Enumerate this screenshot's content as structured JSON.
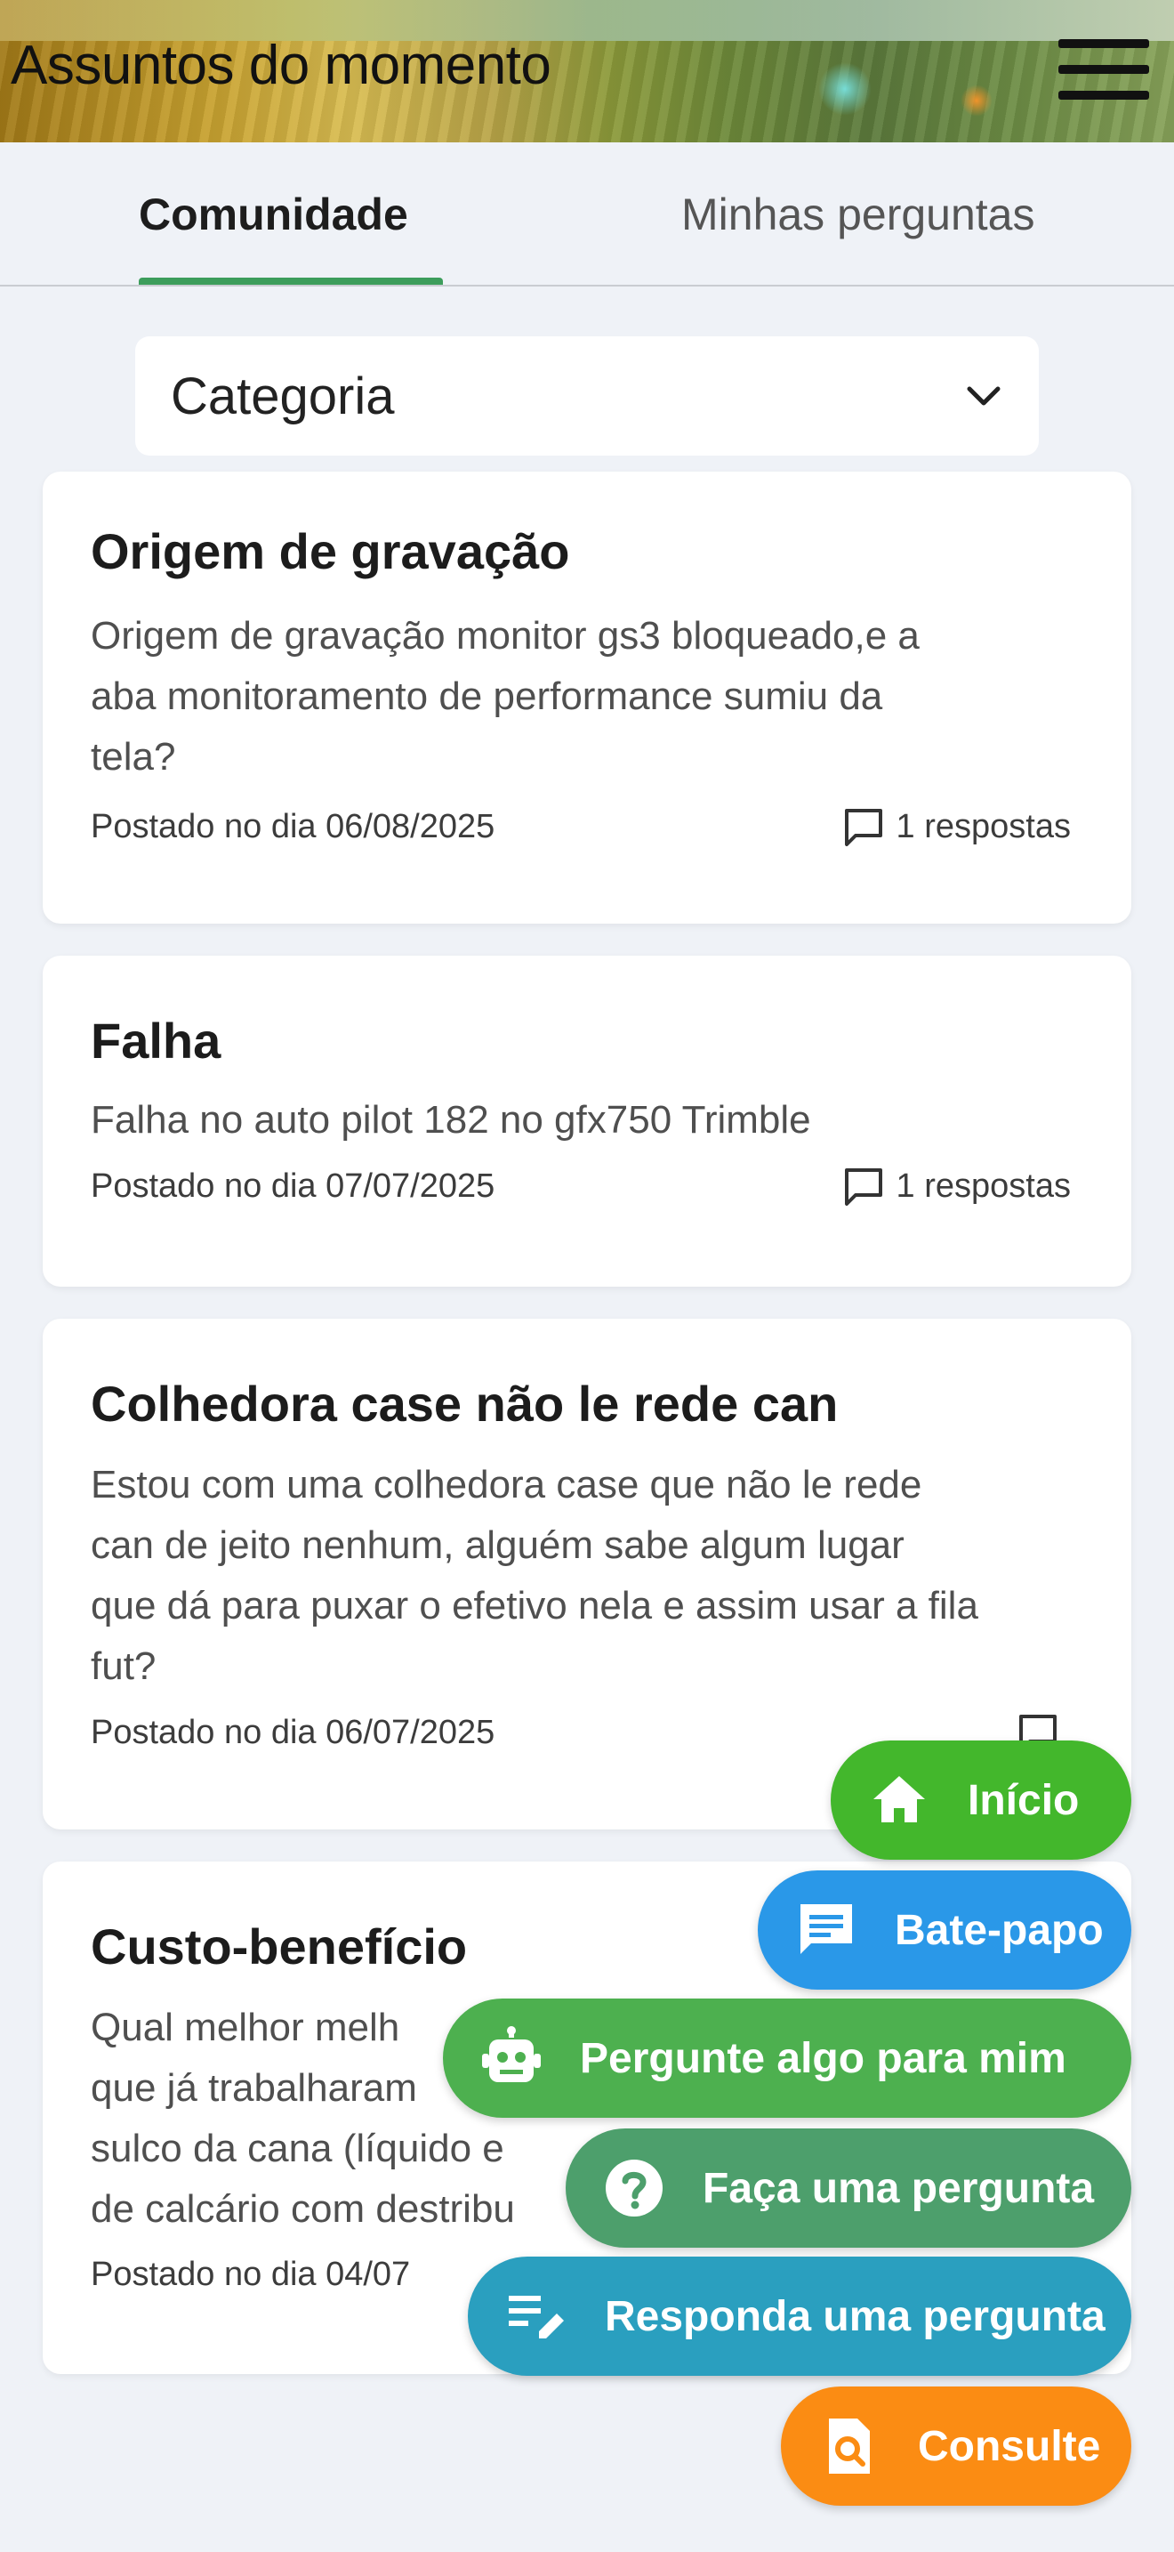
{
  "header": {
    "title": "Assuntos do momento"
  },
  "tabs": [
    {
      "label": "Comunidade",
      "active": true
    },
    {
      "label": "Minhas perguntas",
      "active": false
    }
  ],
  "filter": {
    "label": "Categoria"
  },
  "posts": [
    {
      "title": "Origem de gravação",
      "body_lines": [
        "Origem de gravação monitor gs3 bloqueado,e a",
        "aba monitoramento de performance sumiu da",
        "tela?"
      ],
      "date": "Postado no dia 06/08/2025",
      "replies": "1 respostas"
    },
    {
      "title": "Falha",
      "body_lines": [
        "Falha no auto pilot 182 no gfx750 Trimble"
      ],
      "date": "Postado no dia 07/07/2025",
      "replies": "1 respostas"
    },
    {
      "title": "Colhedora case não le rede can",
      "body_lines": [
        "Estou com uma colhedora case que não le rede",
        "can de jeito nenhum, alguém sabe algum lugar",
        "que dá para puxar o efetivo nela e assim usar a fila",
        "fut?"
      ],
      "date": "Postado no dia 06/07/2025",
      "replies": ""
    },
    {
      "title": "Custo-benefício",
      "body_lines": [
        "Qual melhor melh",
        "que já trabalharam",
        "sulco da cana (líquido e",
        "de calcário com destribu"
      ],
      "date": "Postado no dia 04/07",
      "replies": ""
    }
  ],
  "actions": {
    "inicio": "Início",
    "bate_papo": "Bate-papo",
    "pergunte": "Pergunte algo para mim",
    "faca": "Faça uma pergunta",
    "responda": "Responda uma pergunta",
    "consulte": "Consulte"
  },
  "colors": {
    "background": "#eff2f7",
    "tab_indicator": "#3c9d5b",
    "inicio": "#43b72c",
    "bate_papo": "#2a98e8",
    "pergunte": "#4db04f",
    "faca": "#4d9f6c",
    "responda": "#2a9fbf",
    "consulte": "#fb8c13"
  },
  "icons": {
    "menu": "hamburger-menu-icon",
    "chevron": "chevron-down-icon",
    "replies": "chat-bubble-icon",
    "inicio": "home-icon",
    "bate_papo": "message-icon",
    "pergunte": "robot-icon",
    "faca": "question-icon",
    "responda": "edit-note-icon",
    "consulte": "search-document-icon"
  }
}
